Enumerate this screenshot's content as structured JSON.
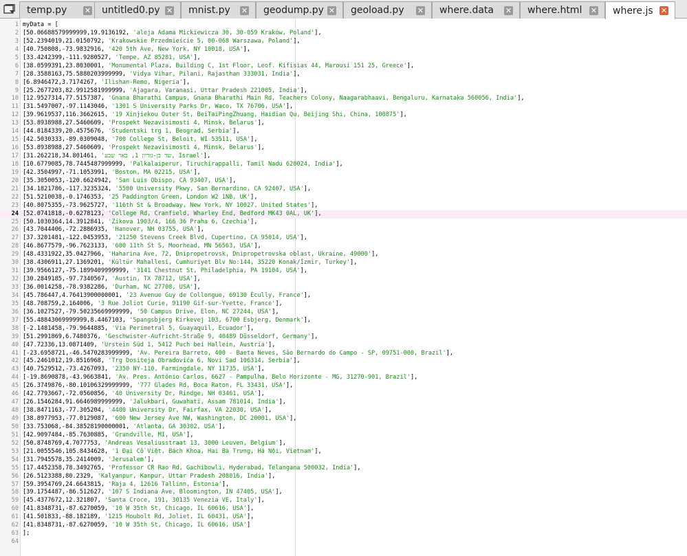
{
  "tabs": [
    {
      "label": "temp.py",
      "active": false
    },
    {
      "label": "untitled0.py",
      "active": false
    },
    {
      "label": "mnist.py",
      "active": false
    },
    {
      "label": "geodump.py",
      "active": false
    },
    {
      "label": "geoload.py",
      "active": false
    },
    {
      "label": "where.data",
      "active": false
    },
    {
      "label": "where.html",
      "active": false
    },
    {
      "label": "where.js",
      "active": true
    }
  ],
  "editor": {
    "current_line": 24,
    "lines": [
      "myData = [",
      "[50.06688579999999,19.9136192, 'aleja Adama Mickiewicza 30, 30-059 Kraków, Poland'],",
      "[52.2394019,21.0150792, 'Krakowskie Przedmieście 5, 00-068 Warszawa, Poland'],",
      "[40.750808,-73.9832916, '420 5th Ave, New York, NY 10018, USA'],",
      "[33.4242399,-111.9280527, 'Tempe, AZ 85281, USA'],",
      "[38.0599391,23.8030001, 'Monumental Plaza, Building C, 1st Floor, Leof. Kifisias 44, Marousi 151 25, Greece'],",
      "[28.3588163,75.5880203999999, 'Vidya Vihar, Pilani, Rajasthan 333031, India'],",
      "[6.8946472,3.7174267, 'Ilishan-Remo, Nigeria'],",
      "[25.2677203,82.9912581999999, 'Ajagara, Varanasi, Uttar Pradesh 221005, India'],",
      "[12.9527314,77.5157387, 'Gnana Bharathi Campus, Gnana Bharathi Main Rd, Teachers Colony, Naagarabhaavi, Bengaluru, Karnataka 560056, India'],",
      "[31.5497007,-97.1143046, '1301 S University Parks Dr, Waco, TX 76706, USA'],",
      "[39.9619537,116.3662615, '19 Xinjiekou Outer St, BeiTaiPingZhuang, Haidian Qu, Beijing Shi, China, 100875'],",
      "[53.8938988,27.5460609, 'Prospekt Nezavisimosti 4, Minsk, Belarus'],",
      "[44.8184339,20.4575676, 'Studentski trg 1, Beograd, Serbia'],",
      "[42.5030333,-89.0309048, '700 College St, Beloit, WI 53511, USA'],",
      "[53.8938988,27.5460609, 'Prospekt Nezavisimosti 4, Minsk, Belarus'],",
      "[31.262218,34.801461, 'שד בן-גוריון 1, באר שבע, Israel'],",
      "[10.6779085,78.7445487999999, 'Palkalaiperur, Tiruchirappalli, Tamil Nadu 620024, India'],",
      "[42.3504997,-71.1053991, 'Boston, MA 02215, USA'],",
      "[35.3050053,-120.6624942, 'San Luis Obispo, CA 93407, USA'],",
      "[34.1821786,-117.3235324, '5500 University Pkwy, San Bernardino, CA 92407, USA'],",
      "[51.5210038,-0.1746353, '25 Paddington Green, London W2 1NB, UK'],",
      "[40.8075355,-73.9625727, '116th St & Broadway, New York, NY 10027, United States'],",
      "[52.0741818,-0.6278123, 'College Rd, Cranfield, Wharley End, Bedford MK43 0AL, UK'],",
      "[50.1030364,14.3912841, 'Zikova 1903/4, 166 36 Praha 6, Czechia'],",
      "[43.7044406,-72.2886935, 'Hanover, NH 03755, USA'],",
      "[37.3201481,-122.0453953, '21250 Stevens Creek Blvd, Cupertino, CA 95014, USA'],",
      "[46.8677579,-96.7623133, '600 11th St S, Moorhead, MN 56563, USA'],",
      "[48.4331922,35.0427966, 'Haharina Ave, 72, Dnipropetrovsk, Dnipropetrovska oblast, Ukraine, 49000'],",
      "[38.4306911,27.1369201, 'Kültür Mahallesi, Cumhuriyet Blv No:144, 35220 Konak/İzmir, Turkey'],",
      "[39.9566127,-75.1899409999999, '3141 Chestnut St, Philadelphia, PA 19104, USA'],",
      "[30.2849185,-97.7340567, 'Austin, TX 78712, USA'],",
      "[36.0014258,-78.9382286, 'Durham, NC 27708, USA'],",
      "[45.786447,4.76413900000001, '23 Avenue Guy de Collongue, 69130 Écully, France'],",
      "[48.708759,2.164006, '3 Rue Joliot Curie, 91190 Gif-sur-Yvette, France'],",
      "[36.1027527,-79.50235669999999, '50 Campus Drive, Elon, NC 27244, USA'],",
      "[55.48843069999999,8.4467103, 'Spangsbjerg Kirkevej 103, 6700 Esbjerg, Denmark'],",
      "[-2.1481458,-79.9644885, 'Vía Perimetral 5, Guayaquil, Ecuador'],",
      "[51.2991869,6.7480376, 'Geschwister-Aufricht-Straße 9, 40489 Düsseldorf, Germany'],",
      "[47.72336,13.0871409, 'Urstein Süd 1, 5412 Puch bei Hallein, Austria'],",
      "[-23.6958721,-46.5470283999999, 'Av. Pereira Barreto, 400 - Baeta Neves, São Bernardo do Campo - SP, 09751-000, Brazil'],",
      "[45.2461012,19.8516968, 'Trg Dositeja Obradovića 6, Novi Sad 106314, Serbia'],",
      "[40.7529512,-73.4267093, '2350 NY-110, Farmingdale, NY 11735, USA'],",
      "[-19.8690878,-43.9663841, 'Av. Pres. Antônio Carlos, 6627 - Pampulha, Belo Horizonte - MG, 31270-901, Brazil'],",
      "[26.3749876,-80.10106329999999, '777 Glades Rd, Boca Raton, FL 33431, USA'],",
      "[42.7793667,-72.0560856, '40 University Dr, Rindge, NH 03461, USA'],",
      "[26.1546284,91.6646989999999, 'Jalukbari, Guwahati, Assam 781014, India'],",
      "[38.8471163,-77.305204, '4400 University Dr, Fairfax, VA 22030, USA'],",
      "[38.8977953,-77.0129087, '600 New Jersey Ave NW, Washington, DC 20001, USA'],",
      "[33.753068,-84.38528190000001, 'Atlanta, GA 30302, USA'],",
      "[42.9097484,-85.7630885, 'Grandville, MI, USA'],",
      "[50.8748769,4.7077753, 'Andreas Vesaliusstraat 13, 3000 Leuven, Belgium'],",
      "[21.0055546,105.8434628, '1 Đại Cồ Việt, Bách Khoa, Hai Bà Trưng, Hà Nội, Vietnam'],",
      "[31.7945578,35.2414009, 'Jerusalem'],",
      "[17.4452358,78.3492765, 'Professor CR Rao Rd, Gachibowli, Hyderabad, Telangana 500032, India'],",
      "[26.5123388,80.2329, 'Kalyanpur, Kanpur, Uttar Pradesh 208016, India'],",
      "[59.3954769,24.6643815, 'Raja 4, 12616 Tallinn, Estonia'],",
      "[39.1754487,-86.512627, '107 S Indiana Ave, Bloomington, IN 47405, USA'],",
      "[45.4377672,12.321807, 'Santa Croce, 191, 30135 Venezia VE, Italy'],",
      "[41.8348731,-87.6270059, '10 W 35th St, Chicago, IL 60616, USA'],",
      "[41.501833,-88.182189, '1215 Houbolt Rd, Joliet, IL 60431, USA'],",
      "[41.8348731,-87.6270059, '10 W 35th St, Chicago, IL 60616, USA']",
      "];",
      ""
    ]
  },
  "colors": {
    "string": "#1a8a1a",
    "active_close": "#e0603a",
    "current_line_bg": "#f7ecf7"
  },
  "icons": {
    "tab_menu": "folder-list-icon",
    "tab_close": "close-icon"
  }
}
